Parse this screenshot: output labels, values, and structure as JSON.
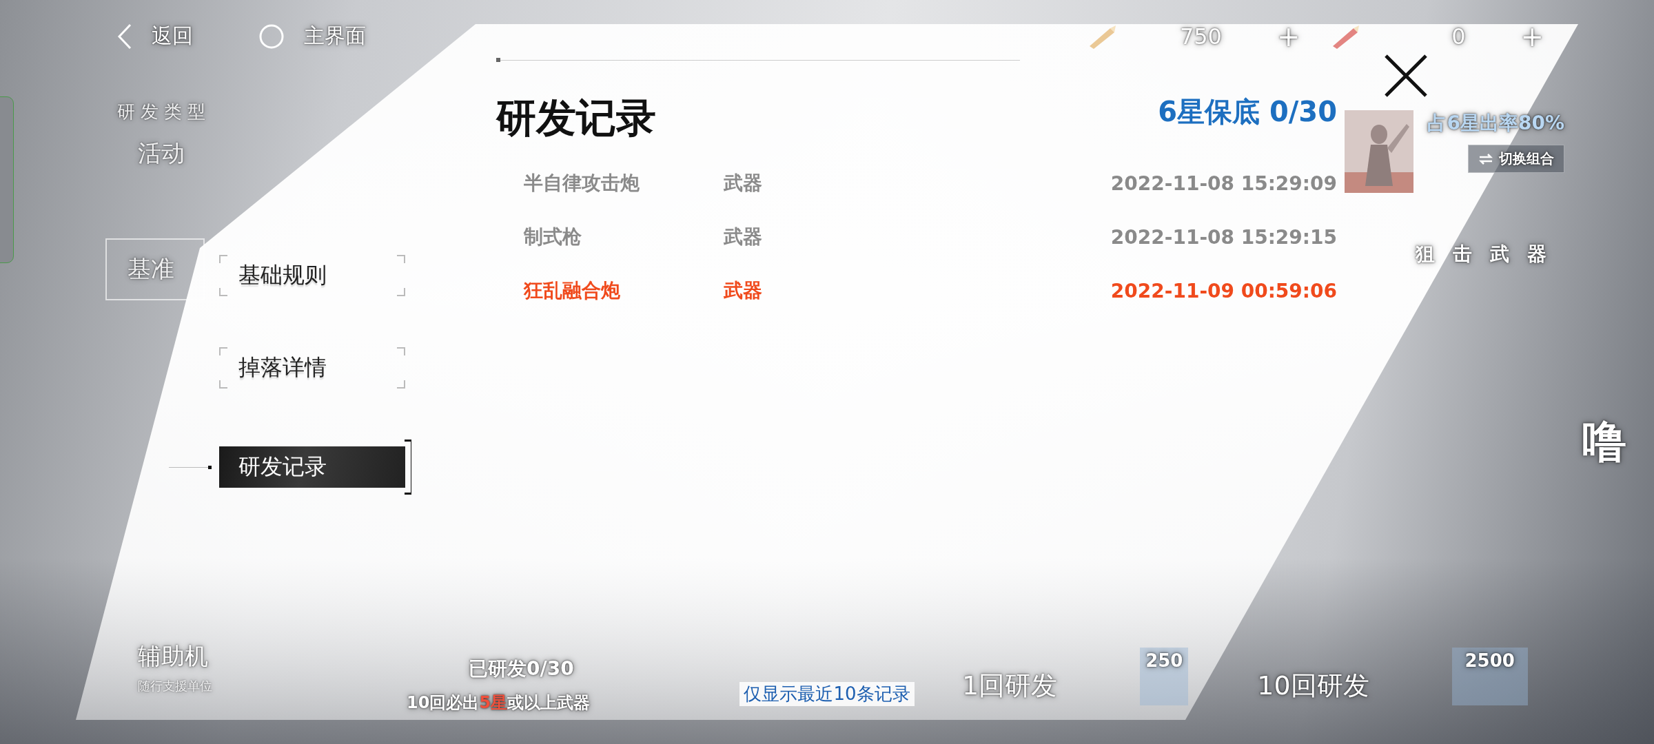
{
  "top_bar": {
    "back": "返回",
    "home": "主界面",
    "currencies": [
      {
        "amount": "750",
        "add": "+"
      },
      {
        "amount": "0",
        "add": "+"
      }
    ]
  },
  "background": {
    "category_label": "研发类型",
    "categories": [
      "活动",
      "基准"
    ],
    "bottom_category": {
      "name": "辅助机",
      "subtitle": "随行支援单位"
    },
    "progress": "已研发0/30",
    "guarantee_note": [
      {
        "text": "10回必出",
        "color": "#ffffff"
      },
      {
        "text": "5星",
        "color": "#f0503c"
      },
      {
        "text": "或以上武器",
        "color": "#ffffff"
      }
    ],
    "draw_buttons": [
      {
        "label": "1回研发",
        "cost": "250"
      },
      {
        "label": "10回研发",
        "cost": "2500"
      }
    ],
    "rate_up": "占6星出率80%",
    "switch_button": "切换组合",
    "weapon_type": "狙击武器",
    "banner_name": "噜"
  },
  "dialog": {
    "title": "研发记录",
    "pity": "6星保底 0/30",
    "tabs": [
      {
        "label": "基础规则",
        "selected": false
      },
      {
        "label": "掉落详情",
        "selected": false
      },
      {
        "label": "研发记录",
        "selected": true
      }
    ],
    "records": [
      {
        "name": "半自律攻击炮",
        "type": "武器",
        "time": "2022-11-08 15:29:09",
        "color": "#8a8a8a"
      },
      {
        "name": "制式枪",
        "type": "武器",
        "time": "2022-11-08 15:29:15",
        "color": "#8a8a8a"
      },
      {
        "name": "狂乱融合炮",
        "type": "武器",
        "time": "2022-11-09 00:59:06",
        "color": "#f04a1c"
      }
    ],
    "footer": "仅显示最近10条记录"
  }
}
